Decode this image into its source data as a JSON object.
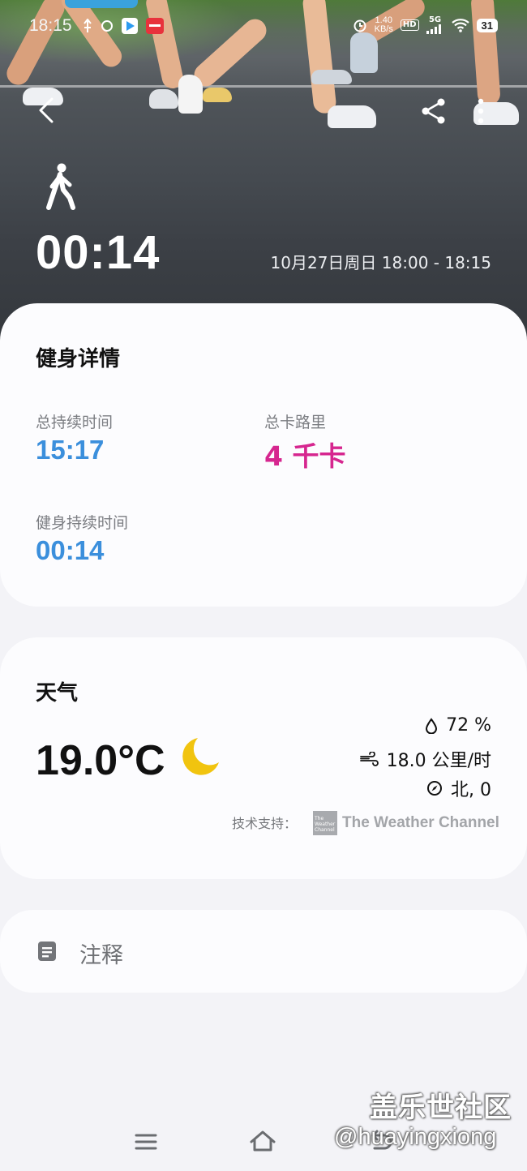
{
  "status_bar": {
    "time": "18:15",
    "net_speed_value": "1.40",
    "net_speed_unit": "KB/s",
    "hd": "HD",
    "signal": "5G",
    "battery": "31"
  },
  "header": {
    "activity_icon": "walking-person-icon",
    "duration": "00:14",
    "date_range": "10月27日周日 18:00 - 18:15"
  },
  "fitness_details": {
    "title": "健身详情",
    "total_duration_label": "总持续时间",
    "total_duration_value": "15:17",
    "total_calories_label": "总卡路里",
    "total_calories_value": "4 千卡",
    "workout_duration_label": "健身持续时间",
    "workout_duration_value": "00:14"
  },
  "weather": {
    "title": "天气",
    "temperature": "19.0°C",
    "condition_icon": "moon-icon",
    "humidity": "72 %",
    "wind_speed": "18.0 公里/时",
    "wind_direction": "北, 0",
    "powered_by_label": "技术支持：",
    "provider_logo_text": "The Weather Channel",
    "provider_name": "The Weather Channel"
  },
  "notes": {
    "label": "注释"
  },
  "watermark": {
    "site": "盖乐世社区",
    "handle": "@huayingxiong"
  },
  "colors": {
    "duration_blue": "#3b8fdc",
    "calories_pink": "#d6268f",
    "moon_yellow": "#f1c40f",
    "card_bg": "#fcfcfe",
    "page_bg": "#f3f3f7"
  }
}
